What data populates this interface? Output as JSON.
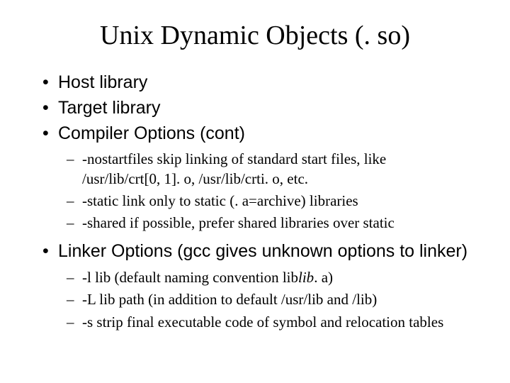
{
  "title": "Unix Dynamic Objects (. so)",
  "bullets": {
    "b0": "Host  library",
    "b1": "Target  library",
    "b2": "Compiler Options (cont)",
    "b2sub": {
      "s0a": "-nostartfiles skip linking of standard start files, like ",
      "s0b": "/usr/lib/crt[0, 1]. o, /usr/lib/crti. o, etc.",
      "s1": "-static link only to static (. a=archive) libraries",
      "s2": "-shared if possible, prefer shared libraries over static"
    },
    "b3": "Linker Options (gcc gives unknown options to linker)",
    "b3sub": {
      "s0a": "-l lib (default naming convention lib",
      "s0b": "lib",
      "s0c": ". a)",
      "s1": "-L lib path (in addition to default /usr/lib and /lib)",
      "s2": "-s strip final executable code of symbol and relocation tables"
    }
  }
}
